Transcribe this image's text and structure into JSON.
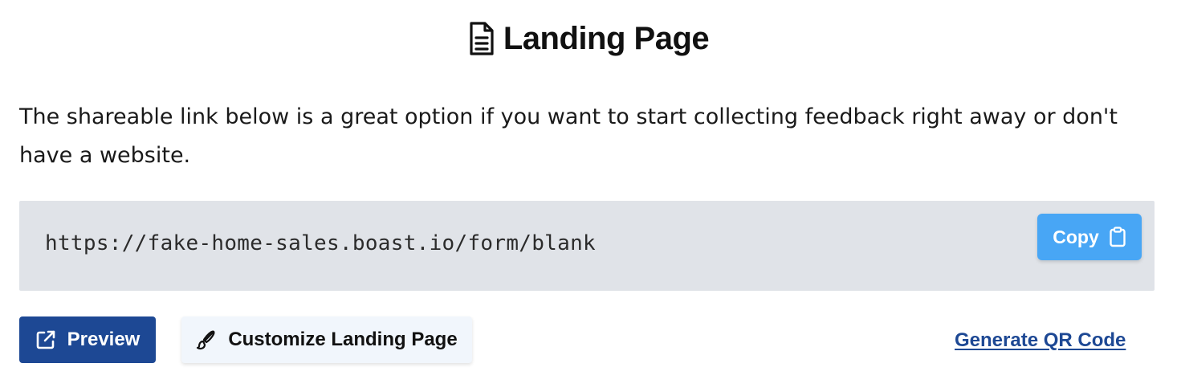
{
  "header": {
    "title": "Landing Page",
    "icon": "document-icon"
  },
  "description": "The shareable link below is a great option if you want to start collecting feedback right away or don't have a website.",
  "share_link": {
    "url": "https://fake-home-sales.boast.io/form/blank",
    "copy_label": "Copy",
    "copy_icon": "clipboard-icon"
  },
  "actions": {
    "preview_label": "Preview",
    "preview_icon": "external-link-icon",
    "customize_label": "Customize Landing Page",
    "customize_icon": "paintbrush-icon",
    "qr_label": "Generate QR Code"
  },
  "colors": {
    "primary": "#1d4894",
    "copy_button": "#48a6f5",
    "link_box_bg": "#e0e3e8",
    "customize_bg": "#f1f6fc"
  }
}
